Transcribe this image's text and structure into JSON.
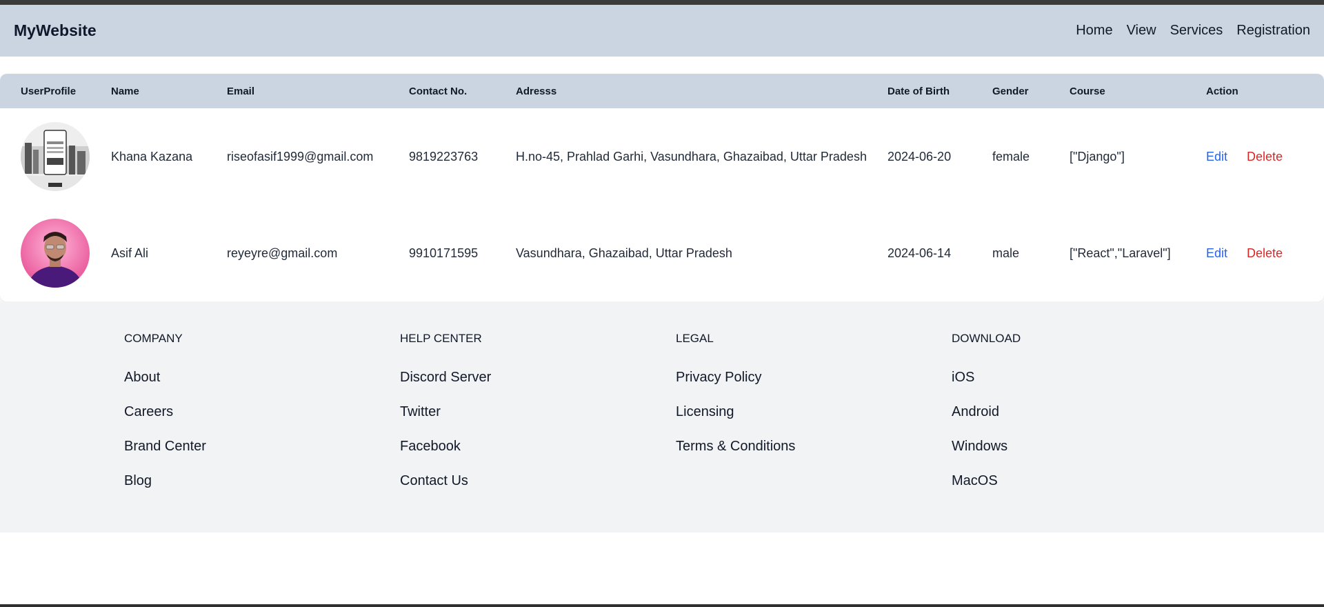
{
  "navbar": {
    "brand": "MyWebsite",
    "links": [
      "Home",
      "View",
      "Services",
      "Registration"
    ]
  },
  "table": {
    "headers": [
      "UserProfile",
      "Name",
      "Email",
      "Contact No.",
      "Adresss",
      "Date of Birth",
      "Gender",
      "Course",
      "Action"
    ],
    "rows": [
      {
        "name": "Khana Kazana",
        "email": "riseofasif1999@gmail.com",
        "contact": "9819223763",
        "address": "H.no-45, Prahlad Garhi, Vasundhara, Ghazaibad, Uttar Pradesh",
        "dob": "2024-06-20",
        "gender": "female",
        "course": "[\"Django\"]",
        "edit": "Edit",
        "delete": "Delete"
      },
      {
        "name": "Asif Ali",
        "email": "reyeyre@gmail.com",
        "contact": "9910171595",
        "address": "Vasundhara, Ghazaibad, Uttar Pradesh",
        "dob": "2024-06-14",
        "gender": "male",
        "course": "[\"React\",\"Laravel\"]",
        "edit": "Edit",
        "delete": "Delete"
      }
    ]
  },
  "footer": {
    "columns": [
      {
        "heading": "COMPANY",
        "links": [
          "About",
          "Careers",
          "Brand Center",
          "Blog"
        ]
      },
      {
        "heading": "HELP CENTER",
        "links": [
          "Discord Server",
          "Twitter",
          "Facebook",
          "Contact Us"
        ]
      },
      {
        "heading": "LEGAL",
        "links": [
          "Privacy Policy",
          "Licensing",
          "Terms & Conditions"
        ]
      },
      {
        "heading": "DOWNLOAD",
        "links": [
          "iOS",
          "Android",
          "Windows",
          "MacOS"
        ]
      }
    ]
  },
  "colors": {
    "navbar_bg": "#cbd5e1",
    "edit": "#2563eb",
    "delete": "#dc2626",
    "footer_bg": "#f2f3f5"
  }
}
